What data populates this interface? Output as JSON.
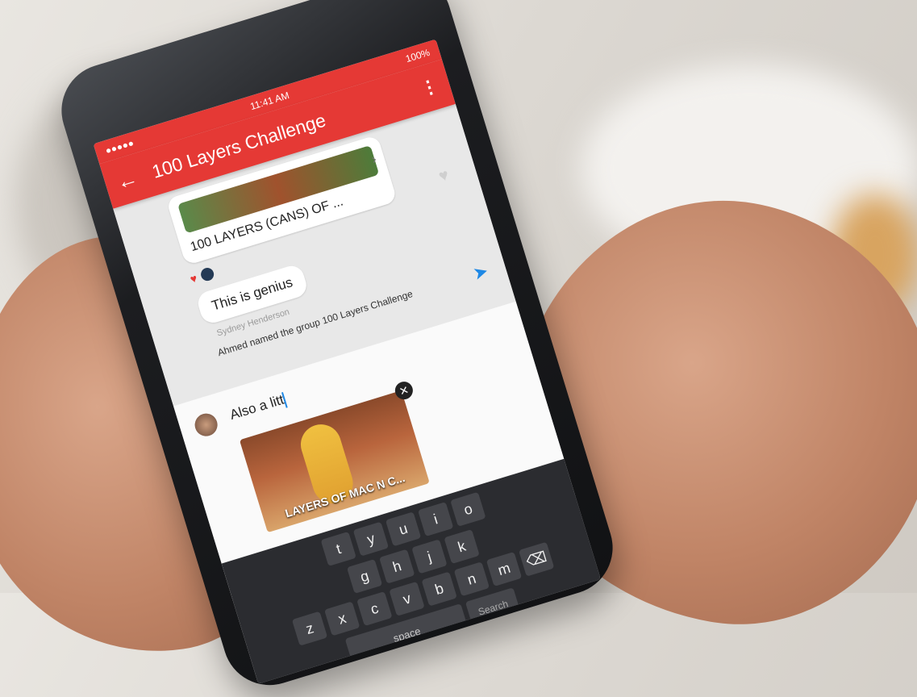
{
  "status": {
    "time": "11:41 AM",
    "battery": "100%",
    "signal": "●●●●●"
  },
  "appbar": {
    "title": "100 Layers Challenge"
  },
  "shared_video": {
    "title": "100 LAYERS (CANS) OF ..."
  },
  "messages": [
    {
      "text": "This is genius",
      "sender": "Sydney Henderson"
    }
  ],
  "system_note": "Ahmed named the group 100 Layers Challenge",
  "compose": {
    "text": "Also a litt",
    "gif_caption": "LAYERS OF MAC N C..."
  },
  "keyboard": {
    "row1": [
      "t",
      "y",
      "u",
      "i",
      "o"
    ],
    "row2": [
      "g",
      "h",
      "j",
      "k"
    ],
    "row3": [
      "z",
      "x",
      "c",
      "v",
      "b",
      "n",
      "m"
    ],
    "space_label": "space",
    "search_label": "Search"
  }
}
